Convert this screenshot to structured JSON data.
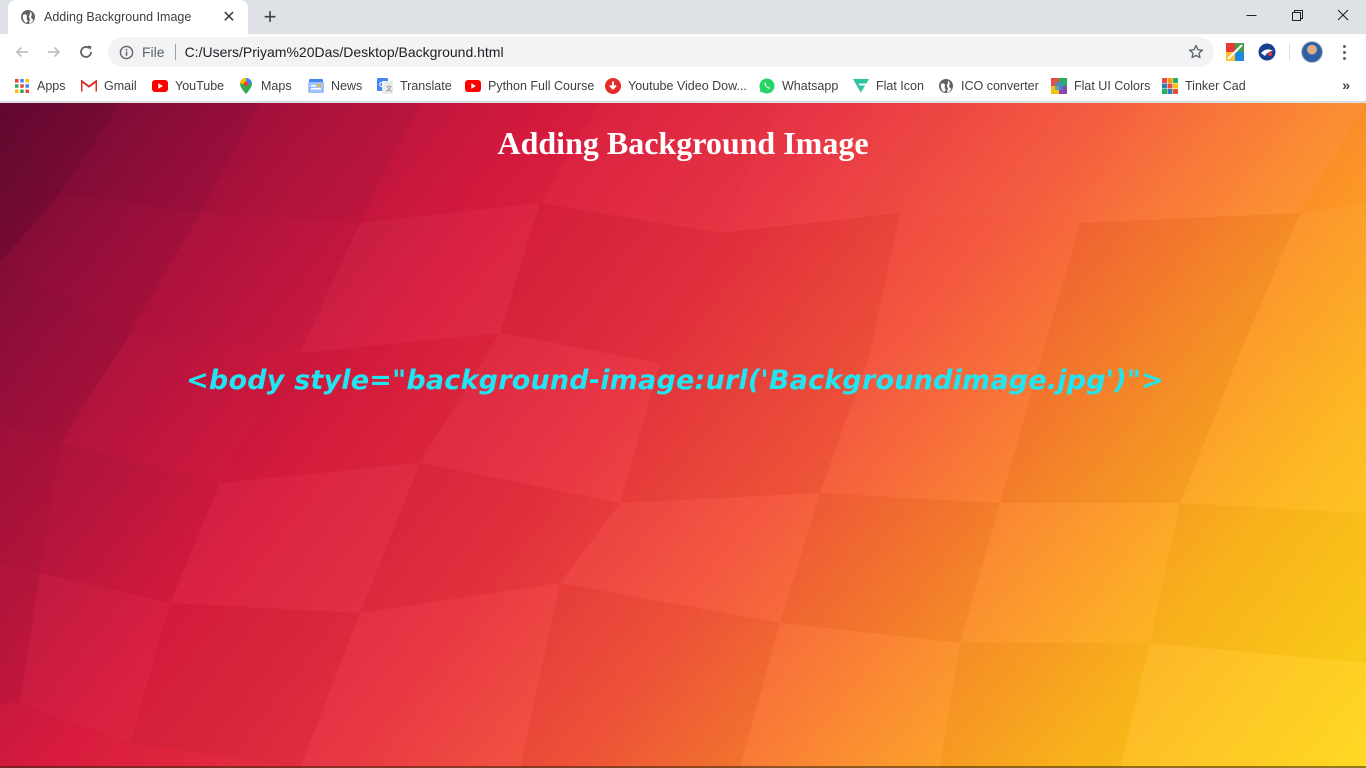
{
  "browser": {
    "tab": {
      "title": "Adding Background Image",
      "icon": "globe-icon"
    },
    "address_bar": {
      "scheme_label": "File",
      "url": "C:/Users/Priyam%20Das/Desktop/Background.html"
    },
    "bookmarks": [
      {
        "label": "Apps",
        "icon": "apps-grid-icon"
      },
      {
        "label": "Gmail",
        "icon": "gmail-icon"
      },
      {
        "label": "YouTube",
        "icon": "youtube-icon"
      },
      {
        "label": "Maps",
        "icon": "maps-pin-icon"
      },
      {
        "label": "News",
        "icon": "news-icon"
      },
      {
        "label": "Translate",
        "icon": "translate-icon"
      },
      {
        "label": "Python Full Course",
        "icon": "youtube-icon"
      },
      {
        "label": "Youtube Video Dow...",
        "icon": "download-icon"
      },
      {
        "label": "Whatsapp",
        "icon": "whatsapp-icon"
      },
      {
        "label": "Flat Icon",
        "icon": "flaticon-icon"
      },
      {
        "label": "ICO converter",
        "icon": "globe-icon"
      },
      {
        "label": "Flat UI Colors",
        "icon": "flat-ui-colors-icon"
      },
      {
        "label": "Tinker Cad",
        "icon": "tinkercad-icon"
      }
    ]
  },
  "page": {
    "heading": "Adding Background Image",
    "code_text": "<body style=\"background-image:url('Backgroundimage.jpg')\">"
  },
  "colors": {
    "heading": "#ffffff",
    "code_text": "#1fe6f2",
    "background_start": "#6b0a35",
    "background_end": "#ffd817"
  }
}
